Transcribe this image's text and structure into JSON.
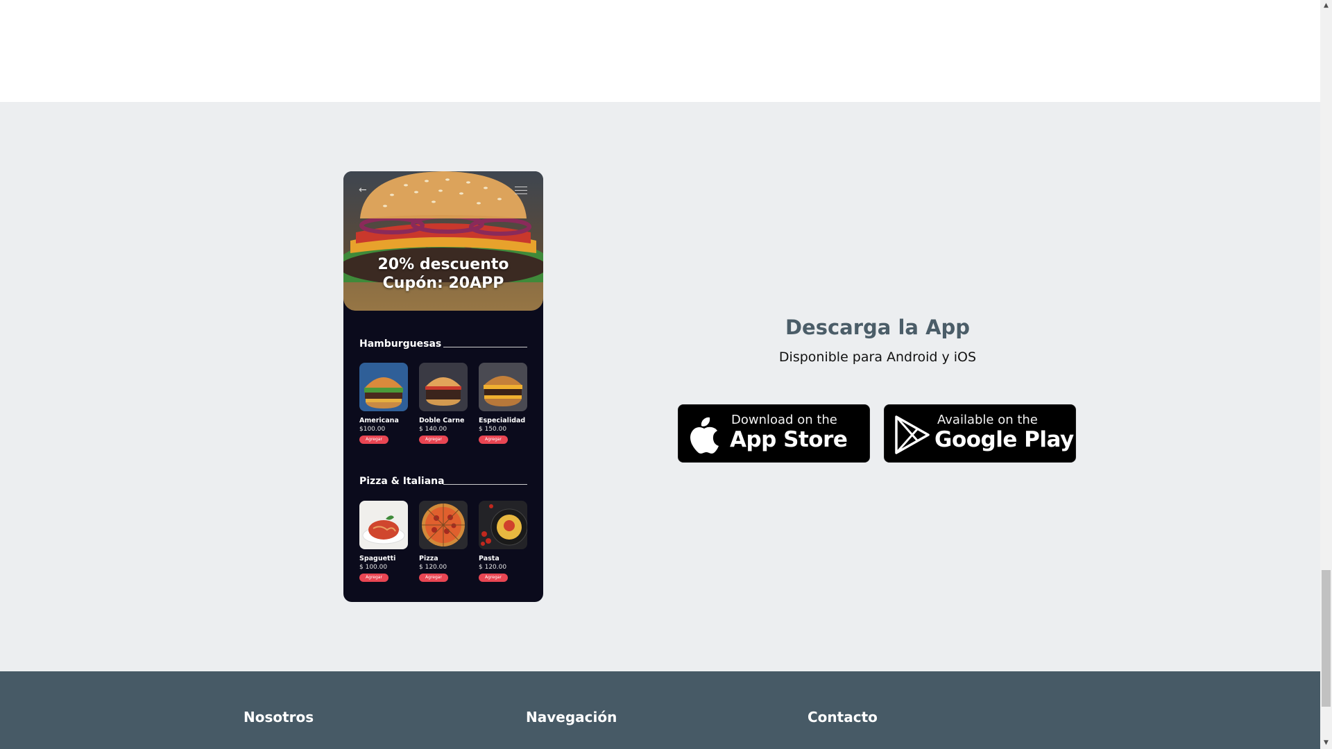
{
  "phone": {
    "hero_line1": "20% descuento",
    "hero_line2": "Cupón: 20APP",
    "categories": [
      {
        "title": "Hamburguesas",
        "items": [
          {
            "name": "Americana",
            "price": "$100.00",
            "button": "Agregar"
          },
          {
            "name": "Doble Carne",
            "price": "$ 140.00",
            "button": "Agregar"
          },
          {
            "name": "Especialidad",
            "price": "$ 150.00",
            "button": "Agregar"
          }
        ]
      },
      {
        "title": "Pizza & Italiana",
        "items": [
          {
            "name": "Spaguetti",
            "price": "$ 100.00",
            "button": "Agregar"
          },
          {
            "name": "Pizza",
            "price": "$ 120.00",
            "button": "Agregar"
          },
          {
            "name": "Pasta",
            "price": "$ 120.00",
            "button": "Agregar"
          }
        ]
      }
    ]
  },
  "download": {
    "title": "Descarga la App",
    "subtitle": "Disponible para Android y iOS",
    "apple_small": "Download on the",
    "apple_big": "App Store",
    "google_small": "Available on the",
    "google_big": "Google Play"
  },
  "footer": {
    "col1": "Nosotros",
    "col2": "Navegación",
    "col3": "Contacto"
  },
  "colors": {
    "section_bg": "#eceef0",
    "footer_bg": "#475a66",
    "phone_bg": "#0b0b1c",
    "accent_red": "#e94653",
    "title_color": "#4b5d68"
  },
  "icons": {
    "back": "arrow-left-icon",
    "menu": "hamburger-menu-icon",
    "apple": "apple-logo-icon",
    "google": "google-play-icon"
  }
}
